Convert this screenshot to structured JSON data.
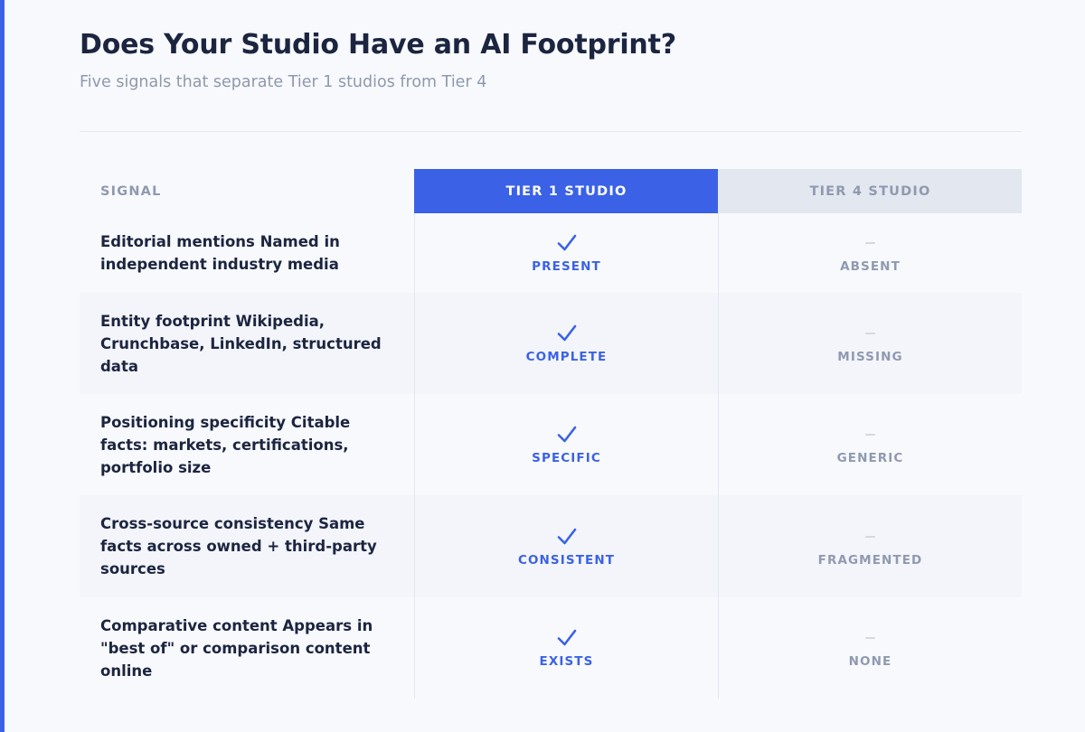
{
  "header": {
    "title": "Does Your Studio Have an AI Footprint?",
    "subtitle": "Five signals that separate Tier 1 studios from Tier 4"
  },
  "colors": {
    "accent": "#3b62e6",
    "title": "#1c2540",
    "muted": "#8f9ab0"
  },
  "table": {
    "columns": [
      "SIGNAL",
      "TIER 1 STUDIO",
      "TIER 4 STUDIO"
    ],
    "rows": [
      {
        "signal": "Editorial mentions Named in independent industry media",
        "tier1": "PRESENT",
        "tier4": "ABSENT"
      },
      {
        "signal": "Entity footprint Wikipedia, Crunchbase, LinkedIn, structured data",
        "tier1": "COMPLETE",
        "tier4": "MISSING"
      },
      {
        "signal": "Positioning specificity Citable facts: markets, certifications, portfolio size",
        "tier1": "SPECIFIC",
        "tier4": "GENERIC"
      },
      {
        "signal": "Cross-source consistency Same facts across owned + third-party sources",
        "tier1": "CONSISTENT",
        "tier4": "FRAGMENTED"
      },
      {
        "signal": "Comparative content Appears in \"best of\" or comparison content online",
        "tier1": "EXISTS",
        "tier4": "NONE"
      }
    ],
    "tier1_icon": "check-icon",
    "tier4_icon": "dash-icon"
  }
}
